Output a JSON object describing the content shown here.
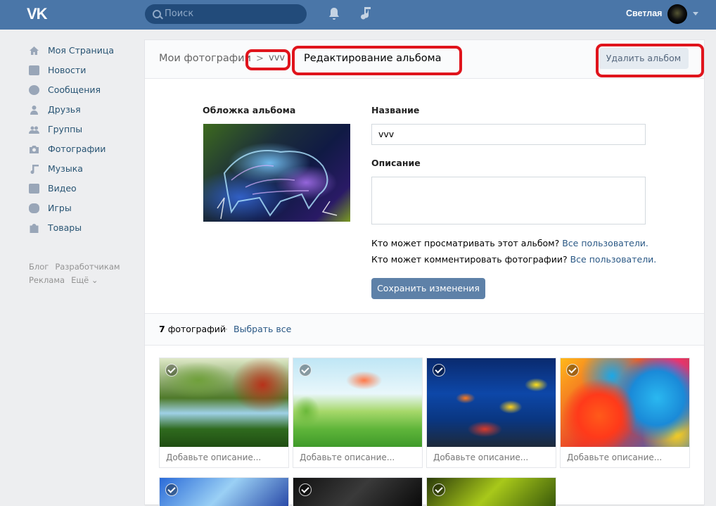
{
  "topbar": {
    "logo": "VK",
    "search_placeholder": "Поиск",
    "user_name": "Светлая",
    "colors": {
      "bar": "#4a76a8"
    }
  },
  "nav": {
    "items": [
      {
        "label": "Моя Страница",
        "icon": "home-icon"
      },
      {
        "label": "Новости",
        "icon": "news-icon"
      },
      {
        "label": "Сообщения",
        "icon": "messages-icon"
      },
      {
        "label": "Друзья",
        "icon": "friends-icon"
      },
      {
        "label": "Группы",
        "icon": "groups-icon"
      },
      {
        "label": "Фотографии",
        "icon": "camera-icon"
      },
      {
        "label": "Музыка",
        "icon": "music-icon"
      },
      {
        "label": "Видео",
        "icon": "video-icon"
      },
      {
        "label": "Игры",
        "icon": "gamepad-icon"
      },
      {
        "label": "Товары",
        "icon": "bag-icon"
      }
    ],
    "footer": {
      "blog": "Блог",
      "developers": "Разработчикам",
      "ads": "Реклама",
      "more": "Ещё ⌄"
    }
  },
  "header": {
    "crumb_photos": "Мои фотографии",
    "crumb_sep": ">",
    "crumb_album": "vvv",
    "title": "Редактирование альбома",
    "delete_button": "Удалить альбом"
  },
  "form": {
    "cover_label": "Обложка альбома",
    "name_label": "Название",
    "name_value": "vvv",
    "desc_label": "Описание",
    "desc_value": "",
    "view_question": "Кто может просматривать этот альбом?",
    "view_value": "Все пользователи.",
    "comment_question": "Кто может комментировать фотографии?",
    "comment_value": "Все пользователи.",
    "save_button": "Сохранить изменения"
  },
  "photos": {
    "count_number": "7",
    "count_label": "фотографий",
    "select_all": "Выбрать все",
    "add_caption": "Добавьте описание...",
    "tiles": [
      {
        "name": "forest-lake-photo"
      },
      {
        "name": "cartoon-landscape-photo"
      },
      {
        "name": "tropical-fish-photo"
      },
      {
        "name": "colorful-flowers-photo"
      },
      {
        "name": "blue-abstract-photo"
      },
      {
        "name": "dark-animal-photo"
      },
      {
        "name": "green-abstract-photo"
      }
    ]
  },
  "annotation_color": "#e0141c"
}
